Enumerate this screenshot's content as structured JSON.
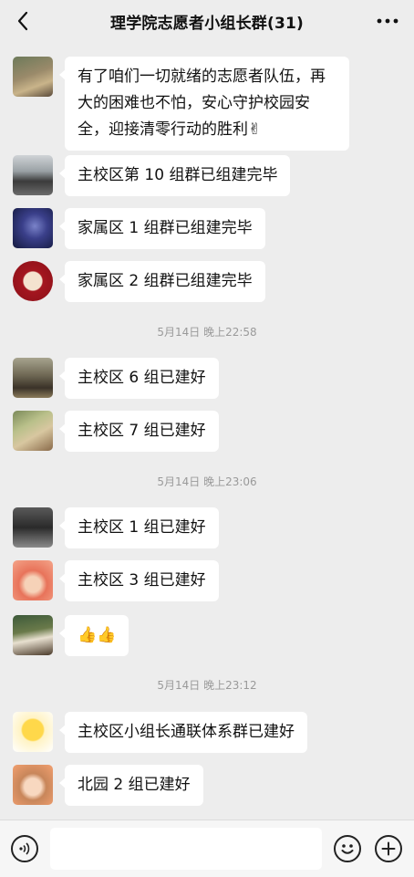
{
  "header": {
    "title": "理学院志愿者小组长群(31)",
    "back_icon": "chevron-left-icon",
    "more_icon": "more-dots-icon"
  },
  "messages": [
    {
      "text": "有了咱们一切就绪的志愿者队伍，再大的困难也不怕，安心守护校园安全，迎接清零行动的胜利✌"
    },
    {
      "text": "主校区第 10 组群已组建完毕"
    },
    {
      "text": "家属区 1 组群已组建完毕"
    },
    {
      "text": "家属区 2 组群已组建完毕"
    },
    {
      "text": "主校区 6 组已建好"
    },
    {
      "text": "主校区 7 组已建好"
    },
    {
      "text": "主校区 1 组已建好"
    },
    {
      "text": "主校区 3 组已建好"
    },
    {
      "text": "👍👍"
    },
    {
      "text": "主校区小组长通联体系群已建好"
    },
    {
      "text": "北园 2 组已建好"
    }
  ],
  "timestamps": [
    "5月14日 晚上22:58",
    "5月14日 晚上23:06",
    "5月14日 晚上23:12"
  ],
  "input_bar": {
    "voice_icon": "voice-icon",
    "emoji_icon": "emoji-icon",
    "plus_icon": "plus-icon",
    "placeholder": ""
  },
  "colors": {
    "background": "#ededed",
    "bubble": "#ffffff",
    "timestamp": "#9a9a9a"
  }
}
